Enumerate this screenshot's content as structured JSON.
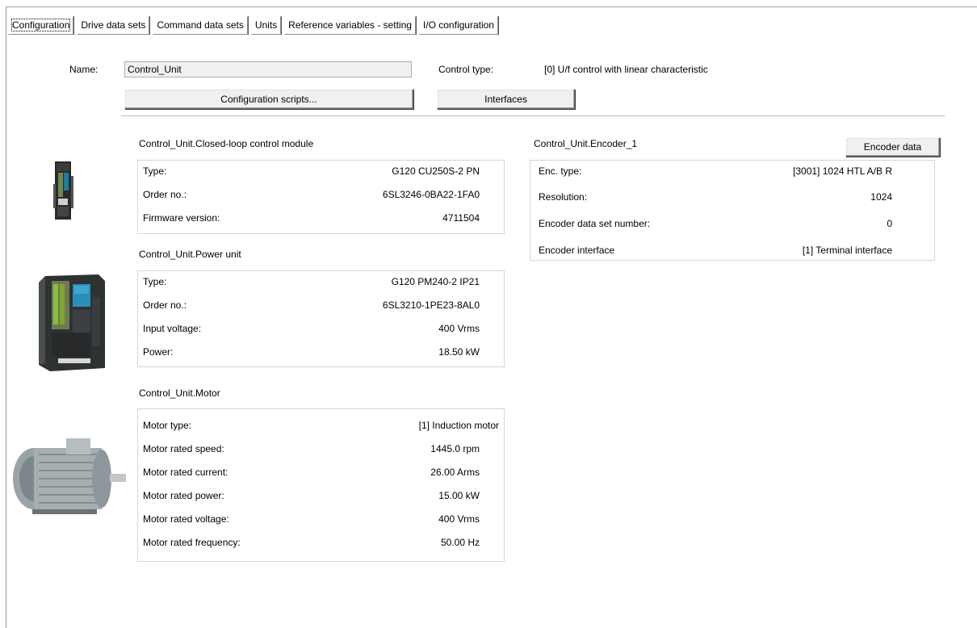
{
  "tabs": [
    {
      "label": "Configuration",
      "active": true
    },
    {
      "label": "Drive data sets",
      "active": false
    },
    {
      "label": "Command data sets",
      "active": false
    },
    {
      "label": "Units",
      "active": false
    },
    {
      "label": "Reference variables - setting",
      "active": false
    },
    {
      "label": "I/O configuration",
      "active": false
    }
  ],
  "header": {
    "name_label": "Name:",
    "name_value": "Control_Unit",
    "control_type_label": "Control type:",
    "control_type_value": "[0] U/f control with linear characteristic",
    "config_scripts_button": "Configuration scripts...",
    "interfaces_button": "Interfaces"
  },
  "control_module": {
    "title": "Control_Unit.Closed-loop control module",
    "rows": [
      {
        "key": "Type:",
        "value": "G120  CU250S-2 PN"
      },
      {
        "key": "Order no.:",
        "value": "6SL3246-0BA22-1FA0"
      },
      {
        "key": "Firmware version:",
        "value": "4711504"
      }
    ]
  },
  "power_unit": {
    "title": "Control_Unit.Power unit",
    "rows": [
      {
        "key": "Type:",
        "value": "G120  PM240-2 IP21"
      },
      {
        "key": "Order no.:",
        "value": "6SL3210-1PE23-8AL0"
      },
      {
        "key": "Input voltage:",
        "value": "400 Vrms"
      },
      {
        "key": "Power:",
        "value": "18.50 kW"
      }
    ]
  },
  "motor": {
    "title": "Control_Unit.Motor",
    "rows": [
      {
        "key": "Motor type:",
        "value": "[1] Induction motor"
      },
      {
        "key": "Motor rated speed:",
        "value": "1445.0 rpm"
      },
      {
        "key": "Motor rated current:",
        "value": "26.00 Arms"
      },
      {
        "key": "Motor rated power:",
        "value": "15.00 kW"
      },
      {
        "key": "Motor rated voltage:",
        "value": "400 Vrms"
      },
      {
        "key": "Motor rated frequency:",
        "value": "50.00 Hz"
      }
    ]
  },
  "encoder": {
    "title": "Control_Unit.Encoder_1",
    "button": "Encoder data",
    "rows": [
      {
        "key": "Enc. type:",
        "value": "[3001] 1024 HTL A/B R"
      },
      {
        "key": "Resolution:",
        "value": "1024"
      },
      {
        "key": "Encoder data set number:",
        "value": "0"
      },
      {
        "key": "Encoder interface",
        "value": "[1] Terminal interface"
      }
    ]
  },
  "icons": {
    "control_unit_image": "control-unit-module-icon",
    "power_unit_image": "power-unit-module-icon",
    "motor_image": "induction-motor-icon"
  }
}
